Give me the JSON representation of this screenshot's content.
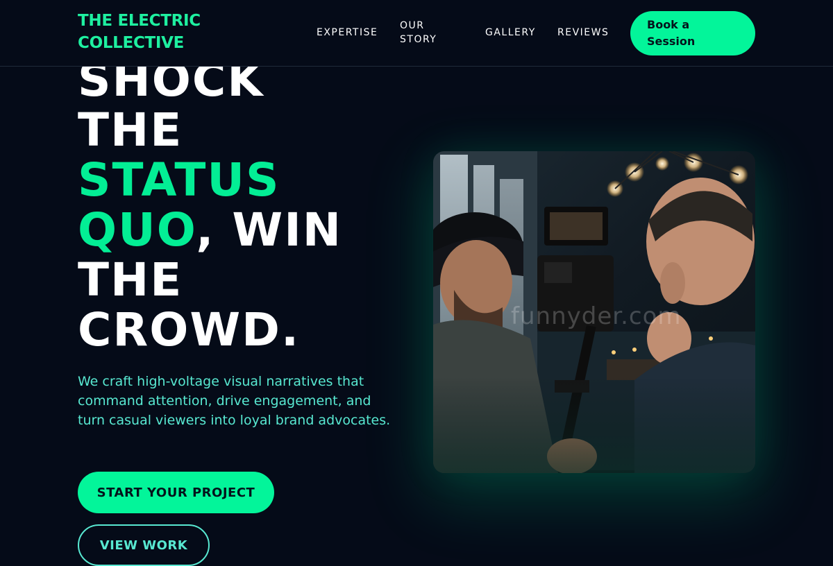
{
  "brand": {
    "line1": "THE ELECTRIC",
    "line2": "COLLECTIVE",
    "accent_color": "#03f59a"
  },
  "nav": {
    "expertise": "EXPERTISE",
    "story": "OUR STORY",
    "gallery": "GALLERY",
    "reviews": "REVIEWS",
    "book_label": "Book a Session"
  },
  "hero": {
    "title_line1": "SHOCK",
    "title_line2": "THE",
    "title_line3": "STATUS",
    "title_line4_accent": "QUO",
    "title_line4_rest": ", WIN",
    "title_line5": "THE",
    "title_line6": "CROWD.",
    "subtitle": "We craft high-voltage visual narratives that command attention, drive engagement, and turn casual viewers into loyal brand advocates.",
    "primary_cta": "START YOUR PROJECT",
    "secondary_cta": "VIEW WORK",
    "image_watermark": "funnyder.com",
    "image_icon": "videographers-photo"
  },
  "colors": {
    "background": "#050b18",
    "accent": "#03f59a",
    "subtitle_text": "#58e8d1"
  }
}
